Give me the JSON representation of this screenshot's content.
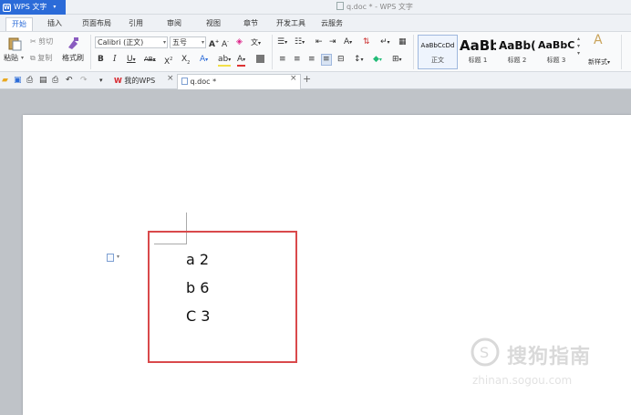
{
  "app": {
    "name": "WPS 文字",
    "window_title": "q.doc * - WPS 文字"
  },
  "menu": [
    "开始",
    "插入",
    "页面布局",
    "引用",
    "审阅",
    "视图",
    "章节",
    "开发工具",
    "云服务"
  ],
  "clipboard": {
    "paste": "粘贴",
    "cut": "剪切",
    "copy": "复制",
    "format_painter": "格式刷"
  },
  "font": {
    "name": "Calibri (正文)",
    "size": "五号"
  },
  "styles": [
    {
      "preview": "AaBbCcDd",
      "name": "正文"
    },
    {
      "preview": "AaBb",
      "name": "标题 1"
    },
    {
      "preview": "AaBb(",
      "name": "标题 2"
    },
    {
      "preview": "AaBbC",
      "name": "标题 3"
    }
  ],
  "new_style": "新样式",
  "tabs": [
    {
      "label": "我的WPS"
    },
    {
      "label": "q.doc *"
    }
  ],
  "document": {
    "lines": [
      "a 2",
      "b 6",
      "C 3"
    ]
  },
  "watermark": {
    "brand": "搜狗指南",
    "url": "zhinan.sogou.com"
  },
  "colors": {
    "accent": "#2b6bd8",
    "highlight_box": "#d9494b",
    "wps_red": "#d7262c"
  }
}
